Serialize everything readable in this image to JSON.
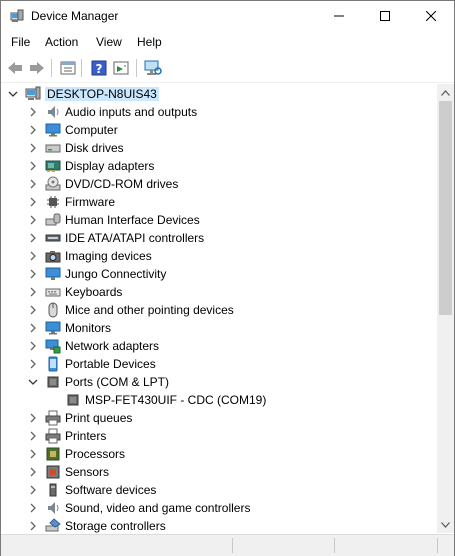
{
  "window": {
    "title": "Device Manager",
    "icon": "device-manager-icon"
  },
  "menu": [
    "File",
    "Action",
    "View",
    "Help"
  ],
  "toolbar": [
    "back-icon",
    "forward-icon",
    "properties-icon",
    "help-icon",
    "show-hidden-icon",
    "scan-hardware-icon"
  ],
  "tree": {
    "root": "DESKTOP-N8UIS43",
    "items": [
      {
        "label": "Audio inputs and outputs",
        "icon": "speaker-icon",
        "expanded": false
      },
      {
        "label": "Computer",
        "icon": "monitor-icon",
        "expanded": false
      },
      {
        "label": "Disk drives",
        "icon": "disk-drive-icon",
        "expanded": false
      },
      {
        "label": "Display adapters",
        "icon": "display-adapter-icon",
        "expanded": false
      },
      {
        "label": "DVD/CD-ROM drives",
        "icon": "dvd-icon",
        "expanded": false
      },
      {
        "label": "Firmware",
        "icon": "chip-icon",
        "expanded": false
      },
      {
        "label": "Human Interface Devices",
        "icon": "hid-icon",
        "expanded": false
      },
      {
        "label": "IDE ATA/ATAPI controllers",
        "icon": "ide-controller-icon",
        "expanded": false
      },
      {
        "label": "Imaging devices",
        "icon": "camera-icon",
        "expanded": false
      },
      {
        "label": "Jungo Connectivity",
        "icon": "network-monitor-icon",
        "expanded": false
      },
      {
        "label": "Keyboards",
        "icon": "keyboard-icon",
        "expanded": false
      },
      {
        "label": "Mice and other pointing devices",
        "icon": "mouse-icon",
        "expanded": false
      },
      {
        "label": "Monitors",
        "icon": "monitor-icon",
        "expanded": false
      },
      {
        "label": "Network adapters",
        "icon": "network-adapter-icon",
        "expanded": false
      },
      {
        "label": "Portable Devices",
        "icon": "portable-device-icon",
        "expanded": false
      },
      {
        "label": "Ports (COM & LPT)",
        "icon": "port-icon",
        "expanded": true
      },
      {
        "label": "MSP-FET430UIF - CDC (COM19)",
        "icon": "port-icon",
        "child": true
      },
      {
        "label": "Print queues",
        "icon": "printer-icon",
        "expanded": false
      },
      {
        "label": "Printers",
        "icon": "printer-icon",
        "expanded": false
      },
      {
        "label": "Processors",
        "icon": "processor-icon",
        "expanded": false
      },
      {
        "label": "Sensors",
        "icon": "sensor-icon",
        "expanded": false
      },
      {
        "label": "Software devices",
        "icon": "software-device-icon",
        "expanded": false
      },
      {
        "label": "Sound, video and game controllers",
        "icon": "speaker-icon",
        "expanded": false
      },
      {
        "label": "Storage controllers",
        "icon": "storage-controller-icon",
        "expanded": false
      }
    ]
  },
  "colors": {
    "selection": "#cce8ff",
    "accent": "#0078d7",
    "chrome": "#f0f0f0"
  }
}
